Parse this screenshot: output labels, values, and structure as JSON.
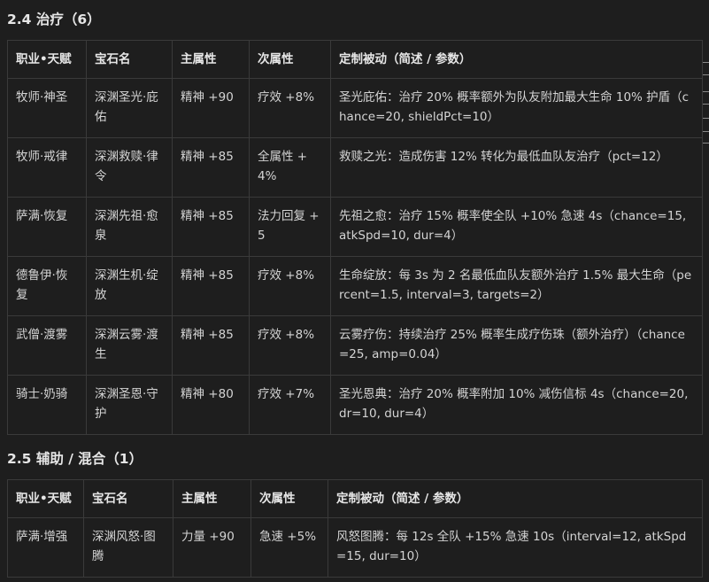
{
  "section_heal": {
    "title": "2.4 治疗（6）",
    "headers": [
      "职业•天赋",
      "宝石名",
      "主属性",
      "次属性",
      "定制被动（简述 / 参数）"
    ],
    "rows": [
      [
        "牧师·神圣",
        "深渊圣光·庇佑",
        "精神 +90",
        "疗效 +8%",
        "圣光庇佑：治疗 20% 概率额外为队友附加最大生命 10% 护盾（chance=20, shieldPct=10）"
      ],
      [
        "牧师·戒律",
        "深渊救赎·律令",
        "精神 +85",
        "全属性 +4%",
        "救赎之光：造成伤害 12% 转化为最低血队友治疗（pct=12）"
      ],
      [
        "萨满·恢复",
        "深渊先祖·愈泉",
        "精神 +85",
        "法力回复 +5",
        "先祖之愈：治疗 15% 概率使全队 +10% 急速 4s（chance=15, atkSpd=10, dur=4）"
      ],
      [
        "德鲁伊·恢复",
        "深渊生机·绽放",
        "精神 +85",
        "疗效 +8%",
        "生命绽放：每 3s 为 2 名最低血队友额外治疗 1.5% 最大生命（percent=1.5, interval=3, targets=2）"
      ],
      [
        "武僧·渡雾",
        "深渊云雾·渡生",
        "精神 +85",
        "疗效 +8%",
        "云雾疗伤：持续治疗 25% 概率生成疗伤珠（额外治疗）（chance=25, amp=0.04）"
      ],
      [
        "骑士·奶骑",
        "深渊圣恩·守护",
        "精神 +80",
        "疗效 +7%",
        "圣光恩典：治疗 20% 概率附加 10% 减伤信标 4s（chance=20, dr=10, dur=4）"
      ]
    ]
  },
  "section_aux": {
    "title": "2.5 辅助 / 混合（1）",
    "headers": [
      "职业•天赋",
      "宝石名",
      "主属性",
      "次属性",
      "定制被动（简述 / 参数）"
    ],
    "rows": [
      [
        "萨满·增强",
        "深渊风怒·图腾",
        "力量 +90",
        "急速 +5%",
        "风怒图腾：每 12s 全队 +15% 急速 10s（interval=12, atkSpd=15, dur=10）"
      ]
    ]
  }
}
